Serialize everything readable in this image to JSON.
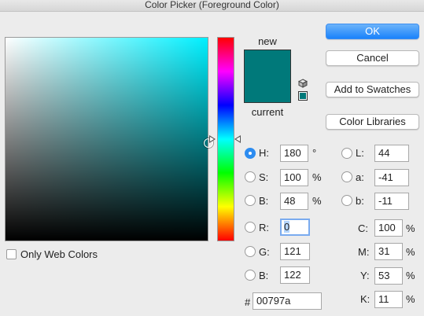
{
  "window": {
    "title": "Color Picker (Foreground Color)"
  },
  "colors": {
    "new": "#00797a",
    "current": "#00797a",
    "field_hue": "#00f0ff",
    "accent": "#1a82fb"
  },
  "swatch": {
    "new_label": "new",
    "current_label": "current"
  },
  "icons": {
    "gamut_warning": "cube-icon",
    "web_safe": "web-safe-swatch-icon"
  },
  "buttons": {
    "ok": "OK",
    "cancel": "Cancel",
    "add_to_swatches": "Add to Swatches",
    "color_libraries": "Color Libraries"
  },
  "only_web_colors": {
    "label": "Only Web Colors",
    "checked": false
  },
  "hsb": {
    "h": {
      "label": "H:",
      "value": "180",
      "unit": "°",
      "selected": true
    },
    "s": {
      "label": "S:",
      "value": "100",
      "unit": "%"
    },
    "b": {
      "label": "B:",
      "value": "48",
      "unit": "%"
    }
  },
  "rgb": {
    "r": {
      "label": "R:",
      "value": "0"
    },
    "g": {
      "label": "G:",
      "value": "121"
    },
    "b": {
      "label": "B:",
      "value": "122"
    }
  },
  "lab": {
    "l": {
      "label": "L:",
      "value": "44"
    },
    "a": {
      "label": "a:",
      "value": "-41"
    },
    "b": {
      "label": "b:",
      "value": "-11"
    }
  },
  "cmyk": {
    "c": {
      "label": "C:",
      "value": "100",
      "unit": "%"
    },
    "m": {
      "label": "M:",
      "value": "31",
      "unit": "%"
    },
    "y": {
      "label": "Y:",
      "value": "53",
      "unit": "%"
    },
    "k": {
      "label": "K:",
      "value": "11",
      "unit": "%"
    }
  },
  "hex": {
    "label": "#",
    "value": "00797a"
  }
}
